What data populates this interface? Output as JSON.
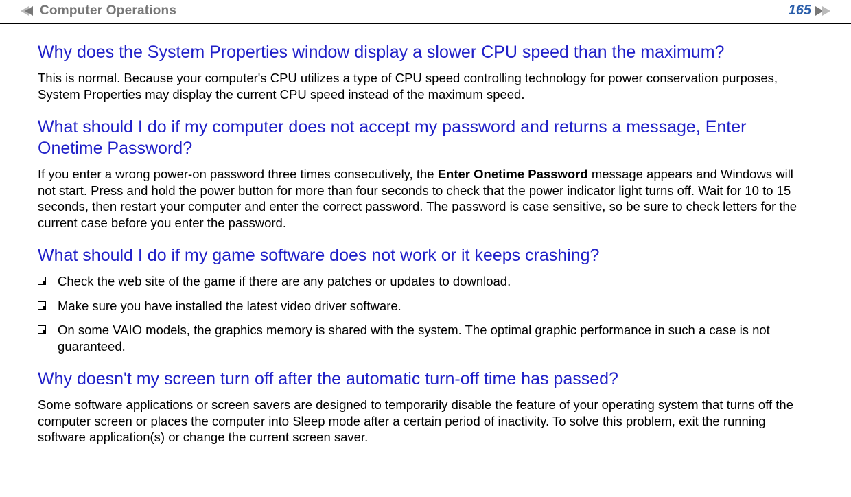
{
  "header": {
    "chapter": "Computer Operations",
    "page_number": "165"
  },
  "sections": [
    {
      "heading": "Why does the System Properties window display a slower CPU speed than the maximum?",
      "paragraphs": [
        "This is normal. Because your computer's CPU utilizes a type of CPU speed controlling technology for power conservation purposes, System Properties may display the current CPU speed instead of the maximum speed."
      ]
    },
    {
      "heading": "What should I do if my computer does not accept my password and returns a message, Enter Onetime Password?",
      "rich_paragraph": {
        "pre": "If you enter a wrong power-on password three times consecutively, the ",
        "bold": "Enter Onetime Password",
        "post": " message appears and Windows will not start. Press and hold the power button for more than four seconds to check that the power indicator light turns off. Wait for 10 to 15 seconds, then restart your computer and enter the correct password. The password is case sensitive, so be sure to check letters for the current case before you enter the password."
      }
    },
    {
      "heading": "What should I do if my game software does not work or it keeps crashing?",
      "bullets": [
        "Check the web site of the game if there are any patches or updates to download.",
        "Make sure you have installed the latest video driver software.",
        "On some VAIO models, the graphics memory is shared with the system. The optimal graphic performance in such a case is not guaranteed."
      ]
    },
    {
      "heading": "Why doesn't my screen turn off after the automatic turn-off time has passed?",
      "paragraphs": [
        "Some software applications or screen savers are designed to temporarily disable the feature of your operating system that turns off the computer screen or places the computer into Sleep mode after a certain period of inactivity. To solve this problem, exit the running software application(s) or change the current screen saver."
      ]
    }
  ]
}
